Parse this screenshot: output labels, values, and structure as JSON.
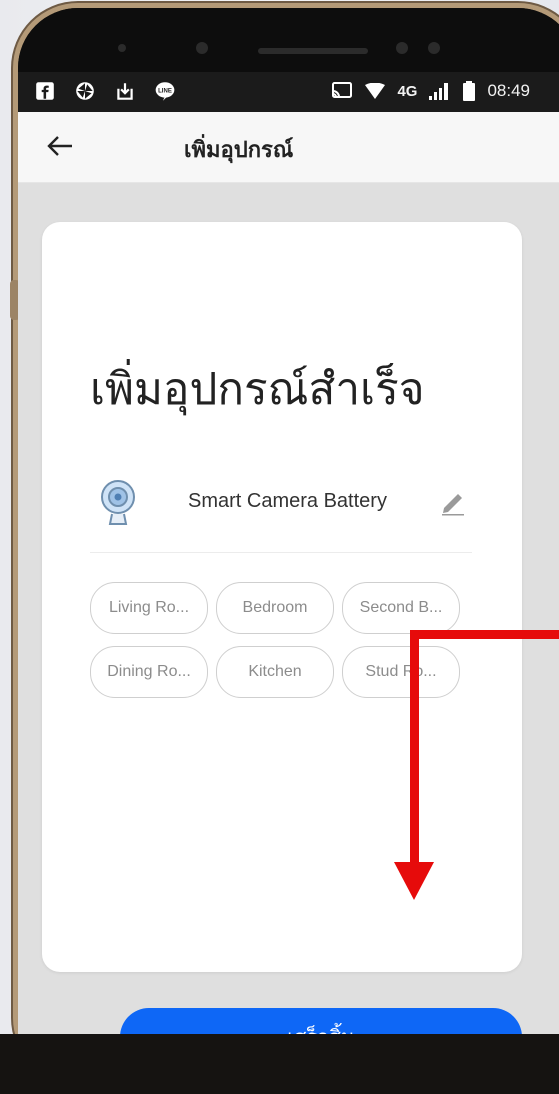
{
  "status_bar": {
    "left_icons": [
      "facebook-icon",
      "pinwheel-icon",
      "download-icon",
      "line-icon"
    ],
    "right": {
      "cast": "cast-icon",
      "wifi": "wifi-icon",
      "network": "4G",
      "signal": "signal-icon",
      "battery": "battery-icon",
      "time": "08:49"
    }
  },
  "header": {
    "title": "เพิ่มอุปกรณ์"
  },
  "main": {
    "heading": "เพิ่มอุปกรณ์สำเร็จ",
    "device": {
      "name": "Smart Camera Battery"
    },
    "rooms": [
      "Living Ro...",
      "Bedroom",
      "Second B...",
      "Dining Ro...",
      "Kitchen",
      "Stud  Ro..."
    ],
    "done_label": "เสร็จสิ้น"
  },
  "colors": {
    "accent": "#0e67f6",
    "annotation_arrow": "#e60b0b"
  }
}
